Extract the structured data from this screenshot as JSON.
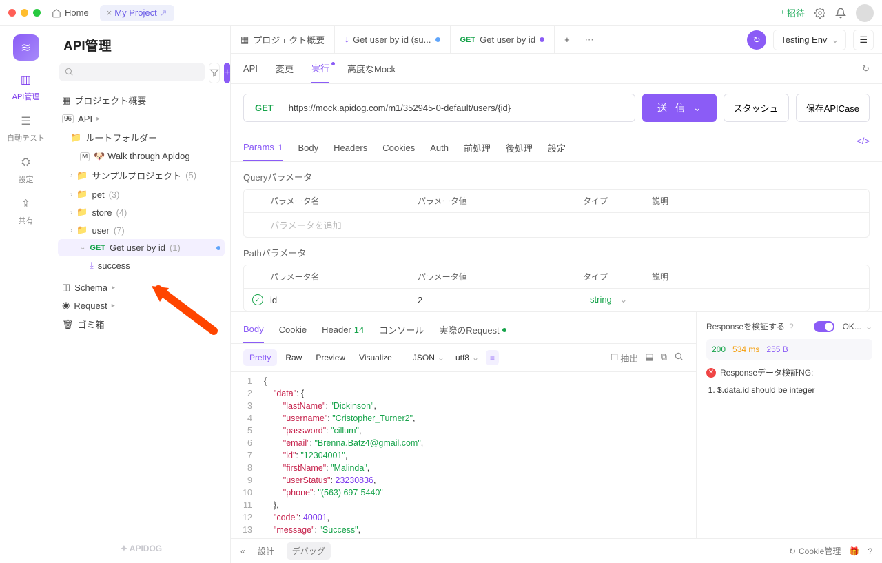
{
  "titlebar": {
    "home": "Home",
    "project_tab": "My Project"
  },
  "topbar_right": {
    "invite": "招待"
  },
  "rail": {
    "items": [
      {
        "label": "API管理"
      },
      {
        "label": "自動テスト"
      },
      {
        "label": "設定"
      },
      {
        "label": "共有"
      }
    ]
  },
  "sidebar": {
    "title": "API管理",
    "project_overview": "プロジェクト概要",
    "api_label": "API",
    "root_folder": "ルートフォルダー",
    "walk": "🐶 Walk through Apidog",
    "sample": "サンプルプロジェクト",
    "sample_count": "(5)",
    "pet": "pet",
    "pet_count": "(3)",
    "store": "store",
    "store_count": "(4)",
    "user": "user",
    "user_count": "(7)",
    "get_user": "Get user by id",
    "get_user_count": "(1)",
    "success": "success",
    "schema": "Schema",
    "request": "Request",
    "trash": "ゴミ箱",
    "brand": "✦ APIDOG"
  },
  "tabs": {
    "overview": "プロジェクト概要",
    "tab1": "Get user by id (su...",
    "tab2": "Get user by id"
  },
  "env": {
    "name": "Testing Env"
  },
  "sub_tabs": {
    "api": "API",
    "change": "変更",
    "run": "実行",
    "mock": "高度なMock"
  },
  "request": {
    "method": "GET",
    "url": "https://mock.apidog.com/m1/352945-0-default/users/{id}",
    "send": "送 信",
    "stash": "スタッシュ",
    "save": "保存APICase"
  },
  "param_tabs": {
    "params": "Params",
    "params_count": "1",
    "body": "Body",
    "headers": "Headers",
    "cookies": "Cookies",
    "auth": "Auth",
    "pre": "前処理",
    "post": "後処理",
    "settings": "設定"
  },
  "query_section": {
    "title": "Queryパラメータ",
    "head_name": "パラメータ名",
    "head_val": "パラメータ値",
    "head_type": "タイプ",
    "head_desc": "説明",
    "placeholder": "パラメータを追加"
  },
  "path_section": {
    "title": "Pathパラメータ",
    "head_name": "パラメータ名",
    "head_val": "パラメータ値",
    "head_type": "タイプ",
    "head_desc": "説明",
    "row_name": "id",
    "row_val": "2",
    "row_type": "string"
  },
  "resp_tabs": {
    "body": "Body",
    "cookie": "Cookie",
    "header": "Header",
    "header_count": "14",
    "console": "コンソール",
    "actual": "実際のRequest"
  },
  "toolbar": {
    "pretty": "Pretty",
    "raw": "Raw",
    "preview": "Preview",
    "visualize": "Visualize",
    "json": "JSON",
    "utf8": "utf8",
    "extract": "抽出"
  },
  "json_body": {
    "data": {
      "lastName": "Dickinson",
      "username": "Cristopher_Turner2",
      "password": "cillum",
      "email": "Brenna.Batz4@gmail.com",
      "id": "12304001",
      "firstName": "Malinda",
      "userStatus": 23230836,
      "phone": "(563) 697-5440"
    },
    "code": 40001,
    "message": "Success"
  },
  "validation": {
    "title": "Responseを検証する",
    "ok": "OK...",
    "status_200": "200",
    "time": "534 ms",
    "size": "255 B",
    "error_title": "Responseデータ検証NG:",
    "error_1": "$.data.id should be integer"
  },
  "footer": {
    "design": "設計",
    "debug": "デバッグ",
    "cookie_mgmt": "Cookie管理"
  }
}
